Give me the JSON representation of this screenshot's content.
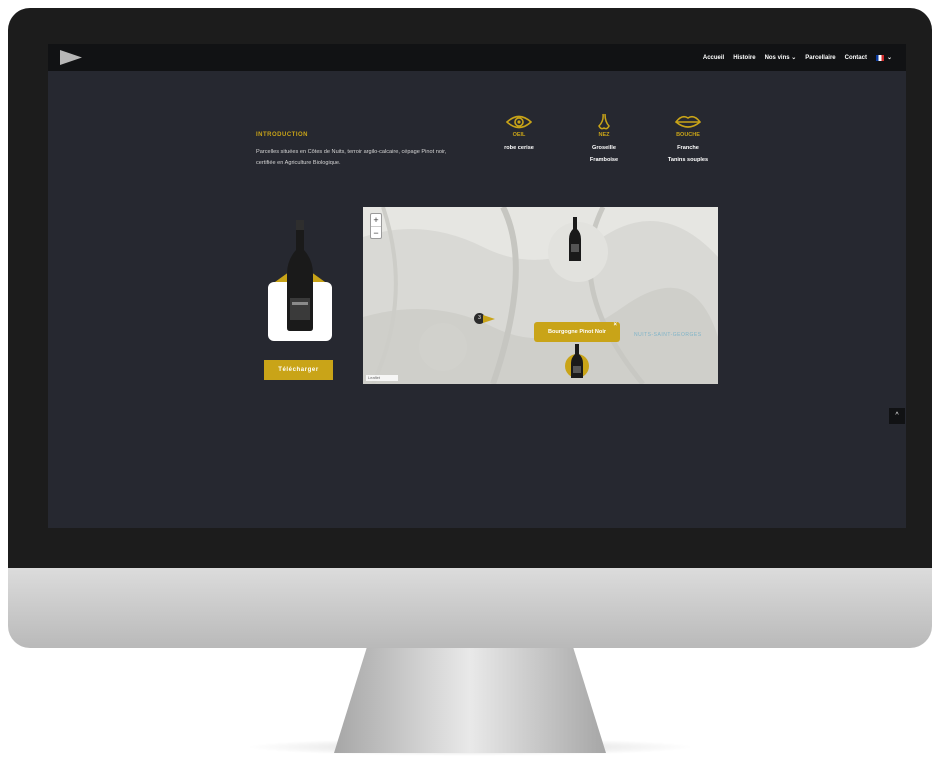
{
  "nav": {
    "items": [
      "Accueil",
      "Histoire",
      "Nos vins ⌄",
      "Parcellaire",
      "Contact"
    ],
    "lang_caret": "⌄"
  },
  "intro": {
    "title": "INTRODUCTION",
    "text": "Parcelles situées en Côtes de Nuits, terroir argilo-calcaire, cépage Pinot noir, certifiée en Agriculture Biologique."
  },
  "senses": [
    {
      "icon": "eye-icon",
      "label": "OEIL",
      "values": [
        "robe cerise"
      ]
    },
    {
      "icon": "nose-icon",
      "label": "NEZ",
      "values": [
        "Groseille",
        "Framboise"
      ]
    },
    {
      "icon": "mouth-icon",
      "label": "BOUCHE",
      "values": [
        "Franche",
        "Tanins souples"
      ]
    }
  ],
  "download_label": "Télécharger",
  "map": {
    "zoom_in": "+",
    "zoom_out": "−",
    "popup_label": "Bourgogne Pinot Noir",
    "popup_close": "×",
    "cluster_count": "3",
    "place_label": "NUITS-SAINT-GEORGES",
    "attribution": "Leaflet"
  },
  "back_to_top": "^",
  "colors": {
    "accent": "#c9a418",
    "screen_bg": "#262830",
    "topbar": "#111214"
  }
}
